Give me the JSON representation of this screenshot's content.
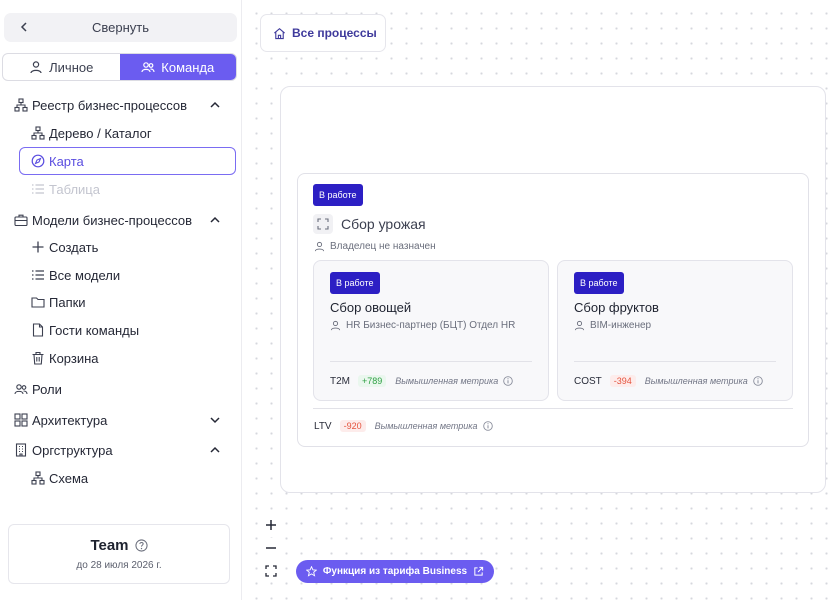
{
  "sidebar": {
    "collapse_label": "Свернуть",
    "tabs": [
      {
        "label": "Личное",
        "icon": "user-icon",
        "active": false
      },
      {
        "label": "Команда",
        "icon": "users-icon",
        "active": true
      }
    ],
    "items": [
      {
        "label": "Реестр бизнес-процессов",
        "icon": "sitemap-icon",
        "expanded": true
      },
      {
        "label": "Дерево / Каталог",
        "icon": "sitemap-icon"
      },
      {
        "label": "Карта",
        "icon": "compass-icon",
        "selected": true
      },
      {
        "label": "Таблица",
        "icon": "list-icon",
        "disabled": true
      },
      {
        "label": "Модели бизнес-процессов",
        "icon": "briefcase-icon",
        "expanded": true
      },
      {
        "label": "Создать",
        "icon": "plus-icon"
      },
      {
        "label": "Все модели",
        "icon": "list-icon"
      },
      {
        "label": "Папки",
        "icon": "folder-icon"
      },
      {
        "label": "Гости команды",
        "icon": "file-icon"
      },
      {
        "label": "Корзина",
        "icon": "trash-icon"
      },
      {
        "label": "Роли",
        "icon": "users-icon"
      },
      {
        "label": "Архитектура",
        "icon": "grid-icon",
        "expanded": false
      },
      {
        "label": "Оргструктура",
        "icon": "building-icon",
        "expanded": true
      },
      {
        "label": "Схема",
        "icon": "sitemap-icon"
      }
    ],
    "team": {
      "name": "Team",
      "date": "до 28 июля 2026 г."
    }
  },
  "canvas": {
    "all_processes_label": "Все процессы",
    "process": {
      "status": "В работе",
      "title": "Сбор урожая",
      "owner": "Владелец не назначен",
      "metric": {
        "code": "LTV",
        "value": "-920",
        "name": "Вымышленная метрика"
      },
      "subprocesses": [
        {
          "status": "В работе",
          "title": "Сбор овощей",
          "owner": "HR Бизнес-партнер (БЦТ) Отдел HR",
          "metric": {
            "code": "T2M",
            "value": "+789",
            "name": "Вымышленная метрика"
          }
        },
        {
          "status": "В работе",
          "title": "Сбор фруктов",
          "owner": "BIM-инженер",
          "metric": {
            "code": "COST",
            "value": "-394",
            "name": "Вымышленная метрика"
          }
        }
      ]
    },
    "zoom": {
      "in": "+",
      "out": "−"
    },
    "business_feature_label": "Функция из тарифа Business"
  },
  "colors": {
    "accent": "#6b5cf0",
    "badge": "#2c1fc4",
    "positive": "#2ea043",
    "negative": "#e5533d"
  }
}
